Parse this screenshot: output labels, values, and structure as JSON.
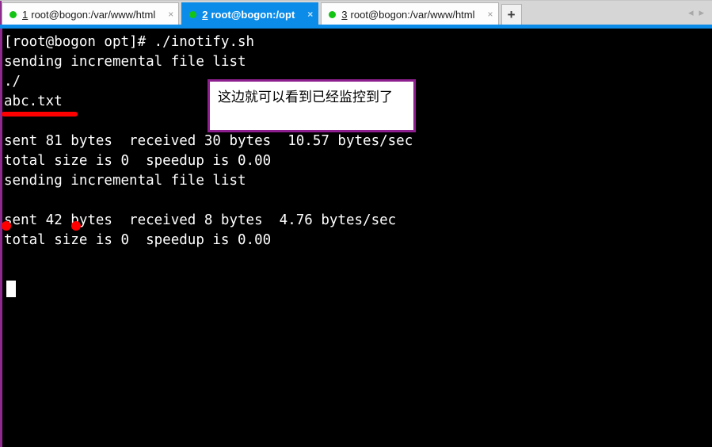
{
  "window": {
    "accent_blue": "#0c8ce9",
    "terminal_border_purple": "#8e2a8e",
    "terminal_bg": "#000000",
    "terminal_fg": "#ffffff"
  },
  "tabbar": {
    "tabs": [
      {
        "number": "1",
        "title": "root@bogon:/var/www/html",
        "status_dot": "status-dot-green",
        "close_label": "×",
        "active": false
      },
      {
        "number": "2",
        "title": "root@bogon:/opt",
        "status_dot": "status-dot-green",
        "close_label": "×",
        "active": true
      },
      {
        "number": "3",
        "title": "root@bogon:/var/www/html",
        "status_dot": "status-dot-green",
        "close_label": "×",
        "active": false
      }
    ],
    "new_tab_label": "+",
    "scroll_left_label": "◂",
    "scroll_right_label": "▸"
  },
  "terminal": {
    "content": "[root@bogon opt]# ./inotify.sh\nsending incremental file list\n./\nabc.txt\n\nsent 81 bytes  received 30 bytes  10.57 bytes/sec\ntotal size is 0  speedup is 0.00\nsending incremental file list\n\nsent 42 bytes  received 8 bytes  4.76 bytes/sec\ntotal size is 0  speedup is 0.00",
    "prompt": "[root@bogon opt]#",
    "command": "./inotify.sh",
    "cursor": "block-cursor"
  },
  "annotations": {
    "callout_text": "这边就可以看到已经监控到了",
    "callout_border_color": "#8e1f8e",
    "underline_color": "#ff0000",
    "underline_target": "abc.txt"
  }
}
